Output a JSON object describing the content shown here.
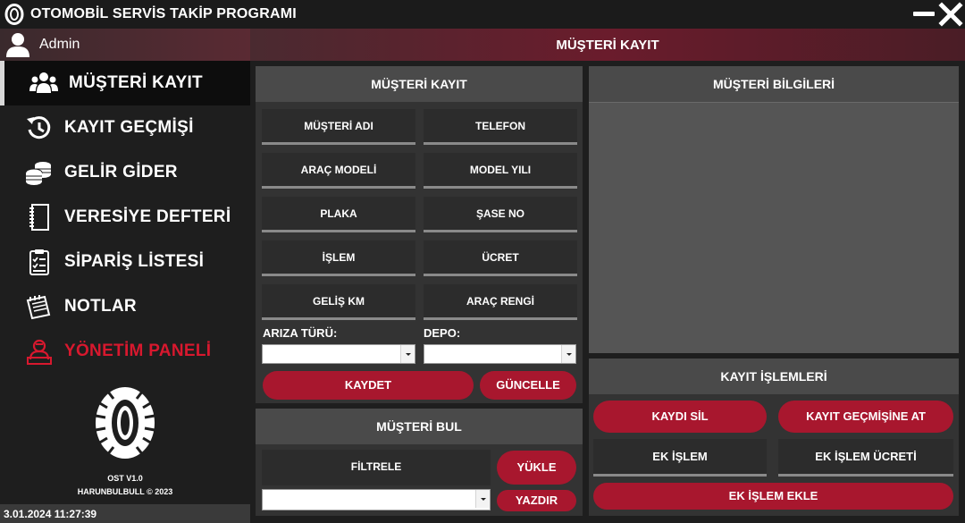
{
  "app": {
    "title": "OTOMOBİL SERVİS TAKİP PROGRAMI"
  },
  "user": {
    "name": "Admin"
  },
  "sidebar": {
    "items": [
      {
        "label": "MÜŞTERİ KAYIT",
        "icon": "users-icon"
      },
      {
        "label": "KAYIT GEÇMİŞİ",
        "icon": "history-icon"
      },
      {
        "label": "GELİR GİDER",
        "icon": "coins-icon"
      },
      {
        "label": "VERESİYE DEFTERİ",
        "icon": "notebook-icon"
      },
      {
        "label": "SİPARİŞ LİSTESİ",
        "icon": "checklist-icon"
      },
      {
        "label": "NOTLAR",
        "icon": "notes-icon"
      },
      {
        "label": "YÖNETİM PANELİ",
        "icon": "admin-icon"
      }
    ],
    "version": "OST V1.0",
    "copyright": "HARUNBULBULL © 2023",
    "datetime": "3.01.2024 11:27:39"
  },
  "main": {
    "title": "MÜŞTERİ KAYIT"
  },
  "customer_form": {
    "title": "MÜŞTERİ KAYIT",
    "fields": [
      "MÜŞTERİ ADI",
      "TELEFON",
      "ARAÇ MODELİ",
      "MODEL YILI",
      "PLAKA",
      "ŞASE NO",
      "İŞLEM",
      "ÜCRET",
      "GELİŞ KM",
      "ARAÇ RENGİ"
    ],
    "fault_type_label": "ARIZA TÜRÜ:",
    "fault_type_value": "",
    "depot_label": "DEPO:",
    "depot_value": "",
    "save_label": "KAYDET",
    "update_label": "GÜNCELLE"
  },
  "find_customer": {
    "title": "MÜŞTERİ BUL",
    "filter_label": "FİLTRELE",
    "filter_value": "",
    "load_label": "YÜKLE",
    "print_label": "YAZDIR"
  },
  "customer_info": {
    "title": "MÜŞTERİ BİLGİLERİ"
  },
  "record_ops": {
    "title": "KAYIT İŞLEMLERİ",
    "delete_label": "KAYDI SİL",
    "to_history_label": "KAYIT GEÇMİŞİNE AT",
    "extra_op_label": "EK İŞLEM",
    "extra_fee_label": "EK İŞLEM ÜCRETİ",
    "add_extra_label": "EK İŞLEM EKLE"
  },
  "colors": {
    "accent": "#a8172e",
    "danger_text": "#d8182e",
    "panel": "#333333",
    "panel_header": "#4a4a4a"
  }
}
